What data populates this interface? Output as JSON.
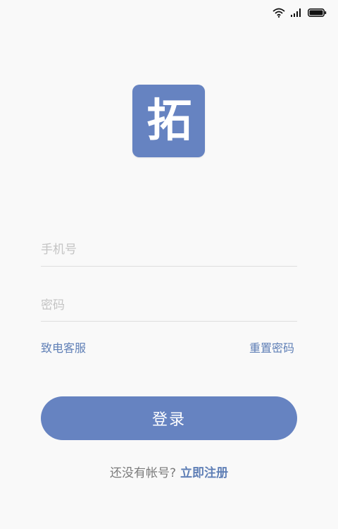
{
  "status_bar": {
    "icons": [
      "wifi-icon",
      "signal-icon",
      "battery-icon"
    ]
  },
  "logo": {
    "char": "拓",
    "color": "#6683c1"
  },
  "form": {
    "phone_placeholder": "手机号",
    "password_placeholder": "密码"
  },
  "links": {
    "contact_service": "致电客服",
    "reset_password": "重置密码"
  },
  "login_button": {
    "label": "登录",
    "color": "#6683c1"
  },
  "register": {
    "prompt": "还没有帐号?",
    "link": "立即注册"
  },
  "colors": {
    "accent": "#6683c1",
    "link": "#5f7fb6",
    "background": "#f9f9f9"
  }
}
